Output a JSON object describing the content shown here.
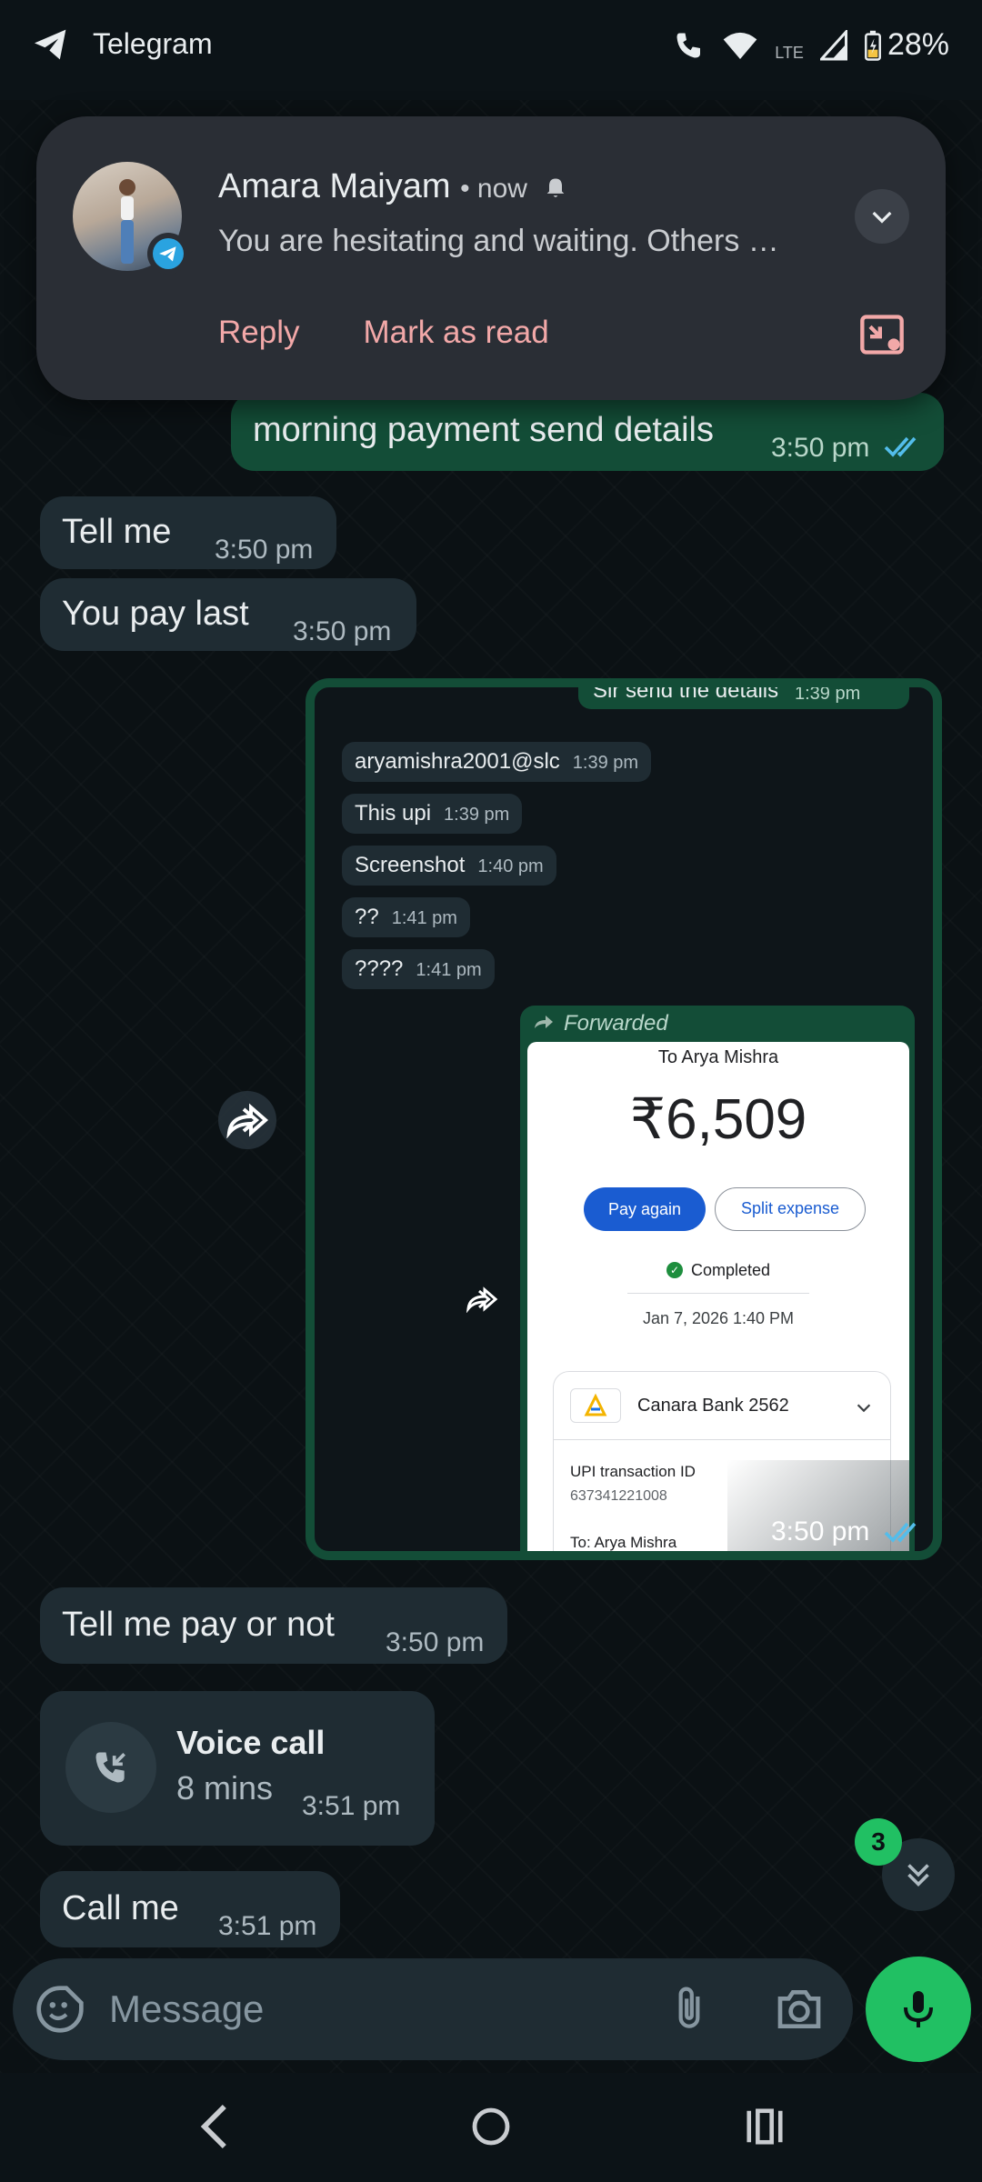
{
  "status_bar": {
    "app_name": "Telegram",
    "network": "LTE",
    "battery": "28%"
  },
  "notification": {
    "sender": "Amara Maiyam",
    "meta": "• now",
    "message": "You are hesitating and waiting. Others …",
    "actions": {
      "reply": "Reply",
      "mark_read": "Mark as read"
    }
  },
  "messages": {
    "m1": {
      "text": "morning payment send details",
      "time": "3:50 pm"
    },
    "m2": {
      "text": "Tell me",
      "time": "3:50 pm"
    },
    "m3": {
      "text": "You pay last",
      "time": "3:50 pm"
    },
    "screenshot": {
      "top_text": "Sir send the details",
      "top_time": "1:39 pm",
      "rows": [
        {
          "text": "aryamishra2001@slc",
          "time": "1:39 pm"
        },
        {
          "text": "This upi",
          "time": "1:39 pm"
        },
        {
          "text": "Screenshot",
          "time": "1:40 pm"
        },
        {
          "text": "??",
          "time": "1:41 pm"
        },
        {
          "text": "????",
          "time": "1:41 pm"
        }
      ],
      "forwarded": "Forwarded",
      "payment": {
        "to": "To Arya Mishra",
        "amount": "₹6,509",
        "pay_again": "Pay again",
        "split": "Split expense",
        "status": "Completed",
        "date": "Jan 7, 2026 1:40 PM",
        "bank": "Canara Bank 2562",
        "txn_label": "UPI transaction ID",
        "txn_id": "637341221008",
        "to_line": "To: Arya Mishra"
      },
      "time": "3:50 pm"
    },
    "m4": {
      "text": "Tell me pay or not",
      "time": "3:50 pm"
    },
    "call": {
      "title": "Voice call",
      "duration": "8 mins",
      "time": "3:51 pm"
    },
    "m5": {
      "text": "Call me",
      "time": "3:51 pm"
    }
  },
  "scroll": {
    "unread_count": "3"
  },
  "composer": {
    "placeholder": "Message"
  },
  "colors": {
    "accent": "#21c063",
    "outgoing": "#134d37",
    "incoming": "#1f2c33",
    "tick_read": "#53bdeb"
  }
}
